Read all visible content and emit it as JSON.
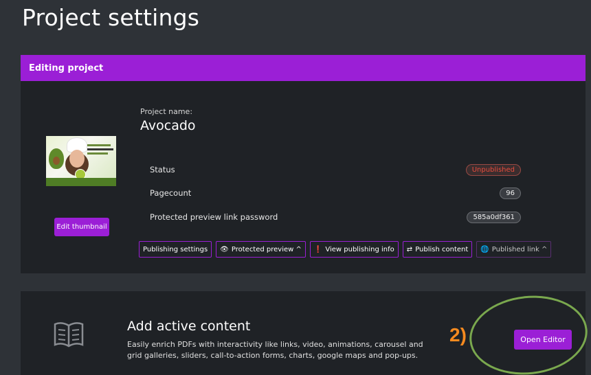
{
  "page": {
    "title": "Project settings"
  },
  "editing": {
    "header": "Editing project",
    "project_label": "Project name:",
    "project_name": "Avocado",
    "edit_thumbnail_label": "Edit thumbnail",
    "info": [
      {
        "label": "Status",
        "value": "Unpublished"
      },
      {
        "label": "Pagecount",
        "value": "96"
      },
      {
        "label": "Protected preview link password",
        "value": "585a0df361"
      }
    ],
    "actions": [
      {
        "icon": "",
        "label": "Publishing settings"
      },
      {
        "icon": "eye-icon",
        "label": "Protected preview ^"
      },
      {
        "icon": "info-icon",
        "label": "View publishing info"
      },
      {
        "icon": "swap-icon",
        "label": "Publish content"
      },
      {
        "icon": "globe-icon",
        "label": "Published link ^"
      }
    ]
  },
  "active_content": {
    "title": "Add active content",
    "description": "Easily enrich PDFs with interactivity like links, video, animations, carousel and grid galleries, sliders, call-to-action forms, charts, google maps and pop-ups.",
    "open_editor_label": "Open Editor",
    "step_annotation": "2)"
  },
  "colors": {
    "accent": "#9b1fd6",
    "unpublished": "#e84c3d",
    "annotation_orange": "#f58a1f",
    "annotation_green": "#7aa84e"
  }
}
